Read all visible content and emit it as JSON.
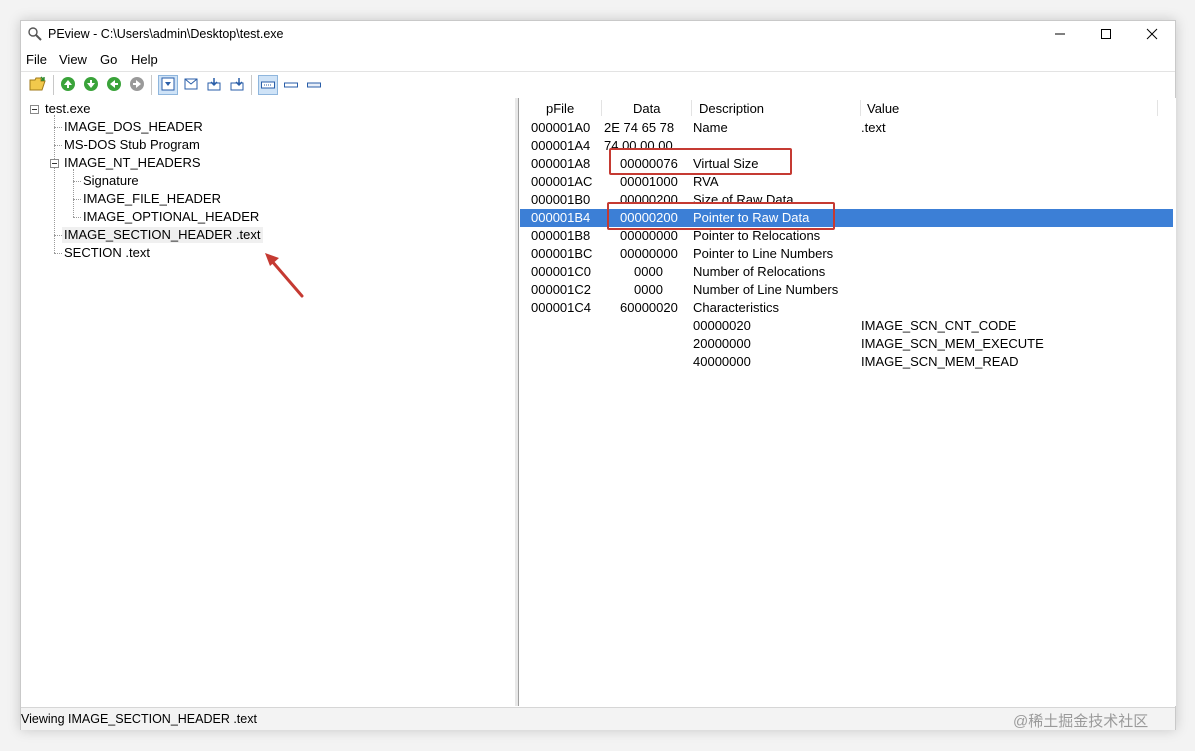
{
  "window": {
    "title": "PEview - C:\\Users\\admin\\Desktop\\test.exe"
  },
  "menu": [
    "File",
    "View",
    "Go",
    "Help"
  ],
  "toolbar": {
    "buttons": [
      "open-icon",
      "back-icon",
      "forward-icon",
      "previous-icon",
      "next-icon",
      "view-hex-icon",
      "view-header-icon",
      "view-section-icon",
      "view-raw-icon",
      "view-large-icon",
      "view-medium-icon",
      "view-small-icon"
    ]
  },
  "tree": {
    "root": "test.exe",
    "nodes": [
      "IMAGE_DOS_HEADER",
      "MS-DOS Stub Program",
      "IMAGE_NT_HEADERS",
      "Signature",
      "IMAGE_FILE_HEADER",
      "IMAGE_OPTIONAL_HEADER",
      "IMAGE_SECTION_HEADER .text",
      "SECTION .text"
    ],
    "selected": "IMAGE_SECTION_HEADER .text"
  },
  "table": {
    "columns": [
      "pFile",
      "Data",
      "Description",
      "Value"
    ],
    "rows": [
      {
        "pfile": "000001A0",
        "data": "2E  74  65  78",
        "description": "Name",
        "value": ".text"
      },
      {
        "pfile": "000001A4",
        "data": "74  00  00  00",
        "description": "",
        "value": ""
      },
      {
        "pfile": "000001A8",
        "data": "00000076",
        "description": "Virtual Size",
        "value": ""
      },
      {
        "pfile": "000001AC",
        "data": "00001000",
        "description": "RVA",
        "value": ""
      },
      {
        "pfile": "000001B0",
        "data": "00000200",
        "description": "Size of Raw Data",
        "value": ""
      },
      {
        "pfile": "000001B4",
        "data": "00000200",
        "description": "Pointer to Raw Data",
        "value": ""
      },
      {
        "pfile": "000001B8",
        "data": "00000000",
        "description": "Pointer to Relocations",
        "value": ""
      },
      {
        "pfile": "000001BC",
        "data": "00000000",
        "description": "Pointer to Line Numbers",
        "value": ""
      },
      {
        "pfile": "000001C0",
        "data": "0000",
        "description": "Number of Relocations",
        "value": ""
      },
      {
        "pfile": "000001C2",
        "data": "0000",
        "description": "Number of Line Numbers",
        "value": ""
      },
      {
        "pfile": "000001C4",
        "data": "60000020",
        "description": "Characteristics",
        "value": ""
      },
      {
        "pfile": "",
        "data": "",
        "description": "00000020",
        "value": "IMAGE_SCN_CNT_CODE"
      },
      {
        "pfile": "",
        "data": "",
        "description": "20000000",
        "value": "IMAGE_SCN_MEM_EXECUTE"
      },
      {
        "pfile": "",
        "data": "",
        "description": "40000000",
        "value": "IMAGE_SCN_MEM_READ"
      }
    ],
    "selected_row": "000001B4"
  },
  "status": {
    "text": "Viewing IMAGE_SECTION_HEADER .text"
  },
  "watermark": "@稀土掘金技术社区",
  "colors": {
    "selection": "#3c7fd6",
    "annotation": "#c53a32"
  }
}
